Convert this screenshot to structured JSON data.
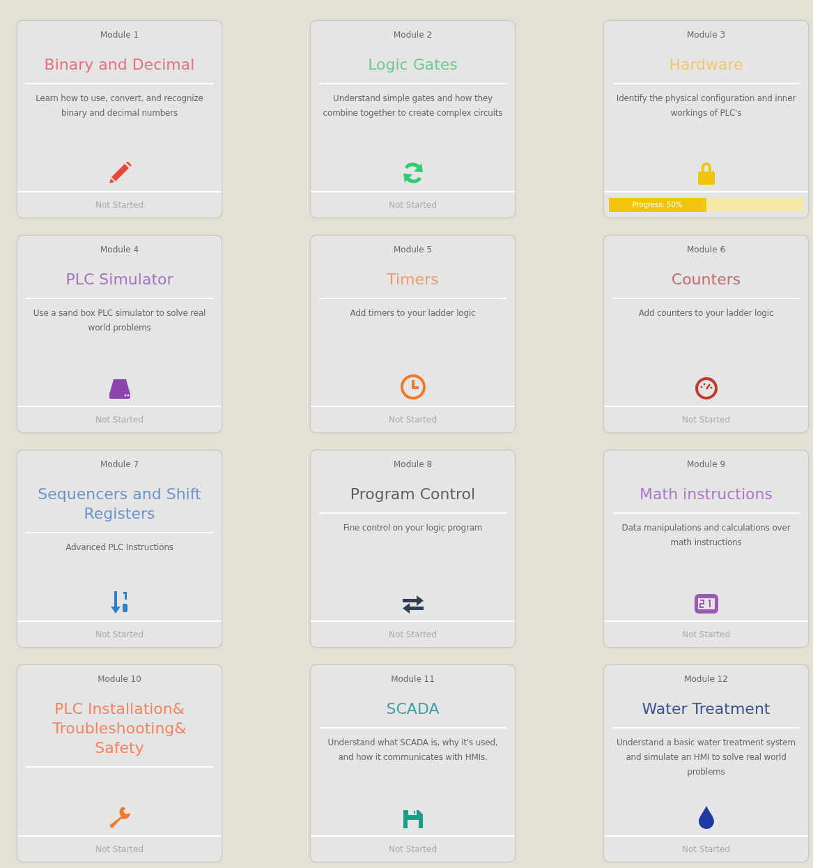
{
  "modules": [
    {
      "label": "Module 1",
      "title": "Binary and Decimal",
      "color": "#e8707a",
      "description": "Learn how to use, convert, and recognize binary and decimal numbers",
      "footer": {
        "kind": "status",
        "text": "Not Started"
      }
    },
    {
      "label": "Module 2",
      "title": "Logic Gates",
      "color": "#6ccb8a",
      "description": "Understand simple gates and how they combine together to create complex circuits",
      "footer": {
        "kind": "status",
        "text": "Not Started"
      }
    },
    {
      "label": "Module 3",
      "title": "Hardware",
      "color": "#f2c66a",
      "description": "Identify the physical configuration and inner workings of PLC's",
      "footer": {
        "kind": "progress",
        "label": "Progress: 50%",
        "level": 0.5
      }
    },
    {
      "label": "Module 4",
      "title": "PLC Simulator",
      "color": "#a374c4",
      "description": "Use a sand box PLC simulator to solve real world problems",
      "footer": {
        "kind": "status",
        "text": "Not Started"
      }
    },
    {
      "label": "Module 5",
      "title": "Timers",
      "color": "#f39a6a",
      "description": "Add timers to your ladder logic",
      "footer": {
        "kind": "status",
        "text": "Not Started"
      }
    },
    {
      "label": "Module 6",
      "title": "Counters",
      "color": "#c46a6a",
      "description": "Add counters to your ladder logic",
      "footer": {
        "kind": "status",
        "text": "Not Started"
      }
    },
    {
      "label": "Module 7",
      "title": "Sequencers and Shift Registers",
      "color": "#6b94cf",
      "description": "Advanced PLC Instructions",
      "footer": {
        "kind": "status",
        "text": "Not Started"
      }
    },
    {
      "label": "Module 8",
      "title": "Program Control",
      "color": "#5a5f6a",
      "description": "Fine control on your logic program",
      "footer": {
        "kind": "status",
        "text": "Not Started"
      }
    },
    {
      "label": "Module 9",
      "title": "Math instructions",
      "color": "#ad76c8",
      "description": "Data manipulations and calculations over math instructions",
      "footer": {
        "kind": "status",
        "text": "Not Started"
      }
    },
    {
      "label": "Module 10",
      "title": "PLC Installation& Troubleshooting& Safety",
      "color": "#f3845f",
      "footer": {
        "kind": "status",
        "text": "Not Started"
      }
    },
    {
      "label": "Module 11",
      "title": "SCADA",
      "color": "#3aa0a8",
      "description": "Understand what SCADA is, why it's used, and how it communicates with HMIs.",
      "footer": {
        "kind": "status",
        "text": "Not Started"
      }
    },
    {
      "label": "Module 12",
      "title": "Water Treatment",
      "color": "#3f4f90",
      "description": "Understand a basic water treatment system and simulate an HMI to solve real world problems",
      "footer": {
        "kind": "status",
        "text": "Not Started"
      }
    }
  ]
}
